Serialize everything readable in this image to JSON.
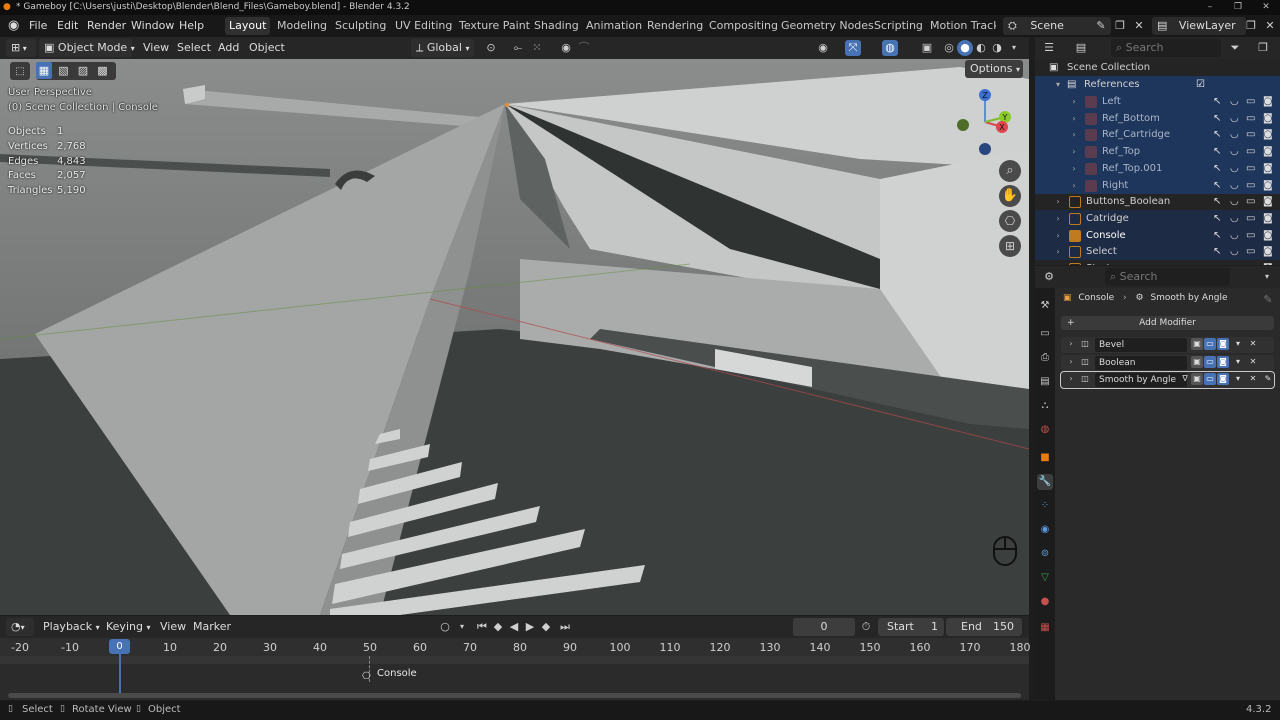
{
  "titlebar": {
    "title": "* Gameboy [C:\\Users\\justi\\Desktop\\Blender\\Blend_Files\\Gameboy.blend] - Blender 4.3.2",
    "minimize": "–",
    "maximize": "❐",
    "close": "✕"
  },
  "menu": {
    "file": "File",
    "edit": "Edit",
    "render": "Render",
    "window": "Window",
    "help": "Help"
  },
  "workspaces": [
    "Layout",
    "Modeling",
    "Sculpting",
    "UV Editing",
    "Texture Paint",
    "Shading",
    "Animation",
    "Rendering",
    "Compositing",
    "Geometry Nodes",
    "Scripting",
    "Motion Tracki"
  ],
  "scene": {
    "name": "Scene",
    "view_layer": "ViewLayer"
  },
  "viewport_header": {
    "mode": "Object Mode",
    "view": "View",
    "select": "Select",
    "add": "Add",
    "object": "Object",
    "orientation": "Global",
    "options": "Options"
  },
  "viewport_overlay": {
    "perspective": "User Perspective",
    "collection": "(0) Scene Collection | Console"
  },
  "stats": [
    {
      "label": "Objects",
      "value": "1"
    },
    {
      "label": "Vertices",
      "value": "2,768"
    },
    {
      "label": "Edges",
      "value": "4,843"
    },
    {
      "label": "Faces",
      "value": "2,057"
    },
    {
      "label": "Triangles",
      "value": "5,190"
    }
  ],
  "gizmo": {
    "z": "Z",
    "y": "Y",
    "x": "X"
  },
  "outliner": {
    "search_placeholder": "Search",
    "root": "Scene Collection",
    "collection": "References",
    "items": [
      {
        "name": "Left",
        "level": 2,
        "selected": true
      },
      {
        "name": "Ref_Bottom",
        "level": 2,
        "selected": true
      },
      {
        "name": "Ref_Cartridge",
        "level": 2,
        "selected": true
      },
      {
        "name": "Ref_Top",
        "level": 2,
        "selected": true
      },
      {
        "name": "Ref_Top.001",
        "level": 2,
        "selected": true
      },
      {
        "name": "Right",
        "level": 2,
        "selected": true
      },
      {
        "name": "Buttons_Boolean",
        "level": 1,
        "selected": false
      },
      {
        "name": "Catridge",
        "level": 1,
        "selected": true
      },
      {
        "name": "Console",
        "level": 1,
        "selected": true,
        "active": true
      },
      {
        "name": "Select",
        "level": 1,
        "selected": true
      },
      {
        "name": "Start",
        "level": 1,
        "selected": false
      }
    ]
  },
  "properties": {
    "search_placeholder": "Search",
    "breadcrumb_object": "Console",
    "breadcrumb_modifier": "Smooth by Angle",
    "add_modifier": "Add Modifier",
    "modifiers": [
      {
        "name": "Bevel"
      },
      {
        "name": "Boolean"
      },
      {
        "name": "Smooth by Angle"
      }
    ]
  },
  "timeline": {
    "playback": "Playback",
    "keying": "Keying",
    "view": "View",
    "marker": "Marker",
    "current_frame": "0",
    "start_label": "Start",
    "start": "1",
    "end_label": "End",
    "end": "150",
    "ticks": [
      "-20",
      "-10",
      "0",
      "10",
      "20",
      "30",
      "40",
      "50",
      "60",
      "70",
      "80",
      "90",
      "100",
      "110",
      "120",
      "130",
      "140",
      "150",
      "160",
      "170",
      "180"
    ],
    "track_label": "Console"
  },
  "statusbar": {
    "select": "Select",
    "rotate": "Rotate View",
    "object": "Object",
    "version": "4.3.2"
  }
}
